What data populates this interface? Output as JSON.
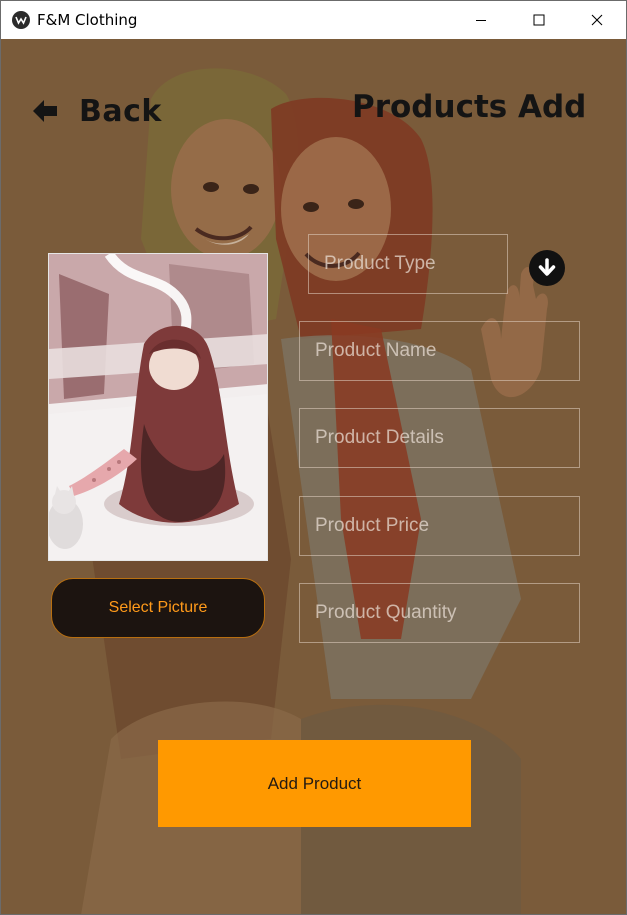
{
  "window": {
    "title": "F&M Clothing",
    "controls": {
      "minimize": "minimize-icon",
      "maximize": "maximize-icon",
      "close": "close-icon"
    }
  },
  "header": {
    "back_label": "Back",
    "back_icon": "arrow-left-icon",
    "title": "Products Add"
  },
  "form": {
    "product_type_placeholder": "Product Type",
    "dropdown_icon": "arrow-down-circle-icon",
    "product_name_placeholder": "Product Name",
    "product_details_placeholder": "Product Details",
    "product_price_placeholder": "Product Price",
    "product_quantity_placeholder": "Product Quantity"
  },
  "actions": {
    "select_picture_label": "Select Picture",
    "add_product_label": "Add Product"
  },
  "colors": {
    "background": "#7a5b3a",
    "accent": "#ff9900",
    "select_text": "#ff9a1a",
    "title_text": "#141414"
  }
}
